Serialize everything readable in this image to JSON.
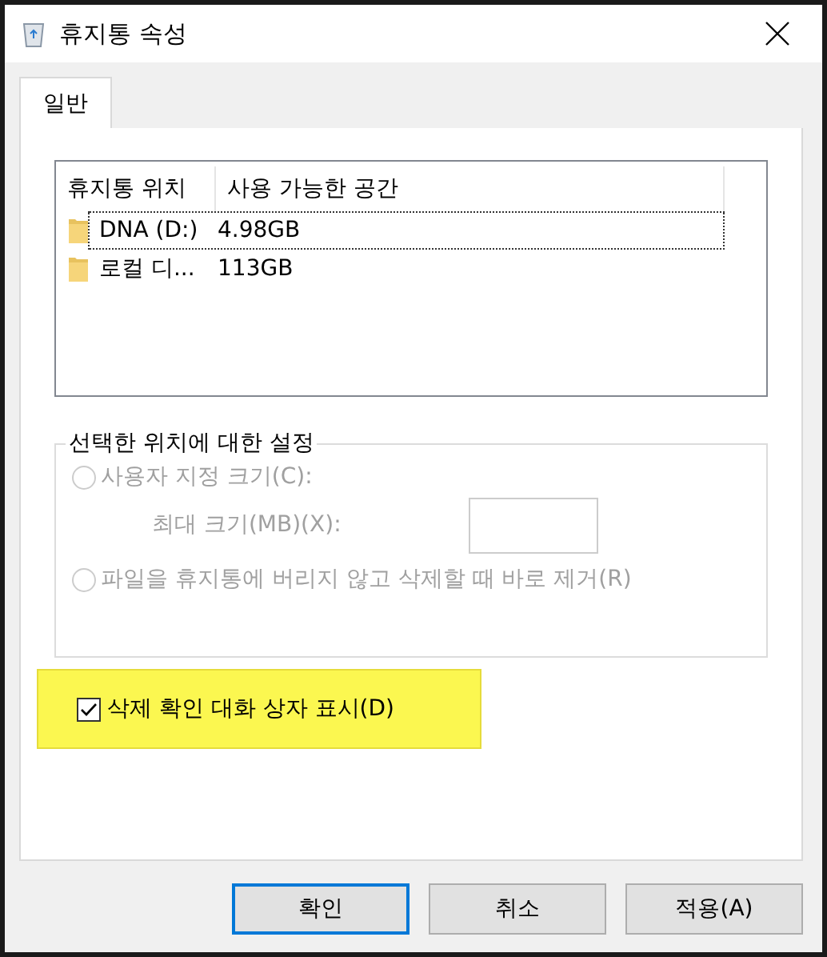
{
  "window": {
    "title": "휴지통 속성"
  },
  "tabs": [
    {
      "label": "일반",
      "selected": true
    }
  ],
  "locations": {
    "columns": [
      "휴지통 위치",
      "사용 가능한 공간"
    ],
    "rows": [
      {
        "location": "DNA (D:)",
        "space": "4.98GB",
        "selected": true
      },
      {
        "location": "로컬 디...",
        "space": "113GB",
        "selected": false
      }
    ]
  },
  "settings": {
    "legend": "선택한 위치에 대한 설정",
    "disabled": true,
    "options": [
      {
        "label": "사용자 지정 크기(C):",
        "selected": false
      },
      {
        "label": "파일을 휴지통에 버리지 않고 삭제할 때 바로 제거(R)",
        "selected": false
      }
    ],
    "max_size_label": "최대 크기(MB)(X):"
  },
  "confirm": {
    "label": "삭제 확인 대화 상자 표시(D)",
    "checked": true,
    "highlighted": true
  },
  "buttons": [
    {
      "label": "확인",
      "default": true
    },
    {
      "label": "취소",
      "default": false
    },
    {
      "label": "적용(A)",
      "default": false
    }
  ]
}
